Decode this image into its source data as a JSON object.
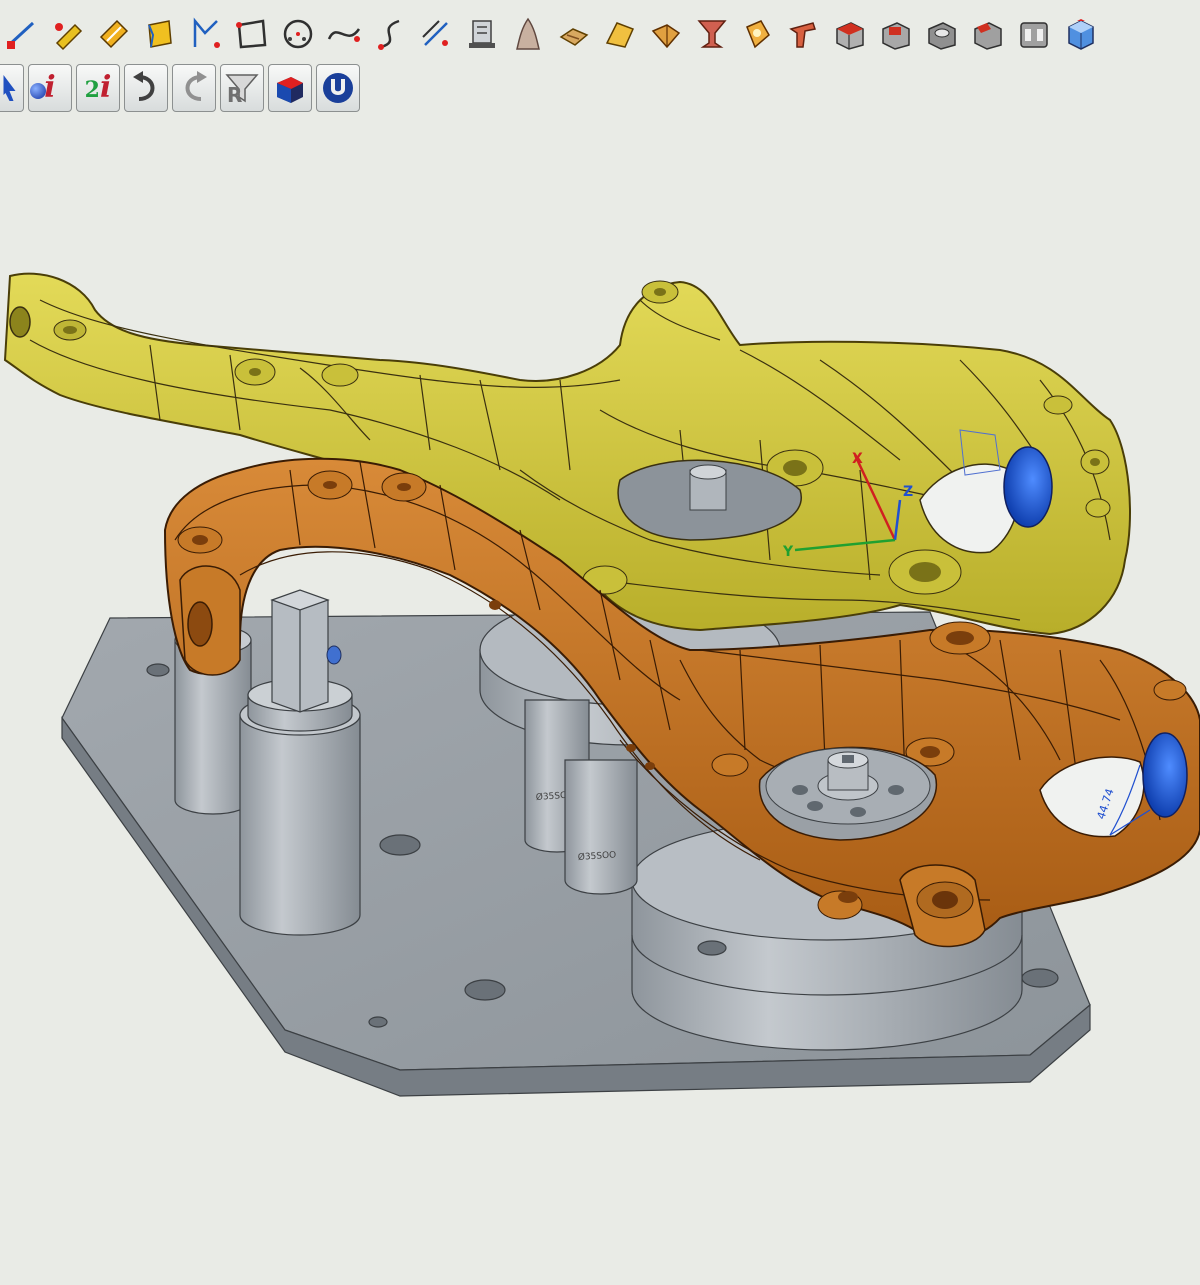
{
  "toolbar_top": {
    "icons": [
      "line-icon",
      "point-pen-icon",
      "brush-icon",
      "surface-icon",
      "curve-icon",
      "rectangle-icon",
      "circle-icon",
      "spline-icon",
      "freeform-curve-icon",
      "offset-icon",
      "sketch-icon",
      "revolve-icon",
      "extrude-icon",
      "loft-icon",
      "sweep-icon",
      "chalice-icon",
      "shell-icon",
      "fillet-icon",
      "red-box-icon",
      "red-box-cut-icon",
      "cylinder-block-icon",
      "boolean-icon",
      "pattern-icon",
      "blue-cube-icon"
    ]
  },
  "toolbar_second": {
    "info_label": "i",
    "info2_number": "2",
    "info2_label": "i",
    "redo_label": "R",
    "icons": [
      "select-icon",
      "info-icon",
      "info-2-icon",
      "undo-icon",
      "redo-icon",
      "filter-icon",
      "solid-box-icon",
      "magnet-icon"
    ]
  },
  "viewport": {
    "axis_labels": {
      "x": "X",
      "y": "Y",
      "z": "Z"
    },
    "dimension_label": "44.74",
    "pillar_labels": [
      "Ø35SOO",
      "Ø35SOO"
    ],
    "colors": {
      "background": "#e9ebe6",
      "yellow_part": "#cdc43a",
      "orange_part": "#c07020",
      "fixture_plate": "#9aa0a6",
      "hole_blue": "#1c5cd8",
      "axis_x": "#d02020",
      "axis_y": "#20a030",
      "axis_z": "#2050d0"
    }
  }
}
